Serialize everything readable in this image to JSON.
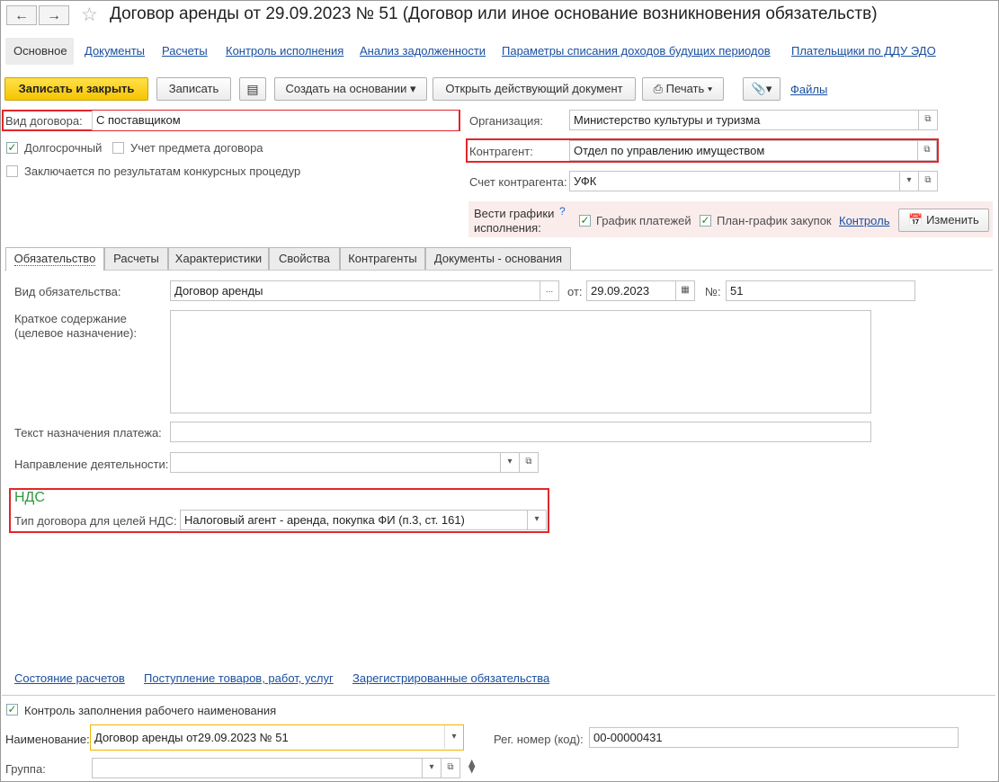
{
  "window": {
    "title": "Договор аренды от 29.09.2023 № 51 (Договор или иное основание возникновения обязательств)"
  },
  "nav_tabs": [
    "Основное",
    "Документы",
    "Расчеты",
    "Контроль исполнения",
    "Анализ задолженности",
    "Параметры списания доходов будущих периодов",
    "Плательщики по ДДУ ЭДО"
  ],
  "toolbar": {
    "save_close": "Записать и закрыть",
    "save": "Записать",
    "create_based": "Создать на основании",
    "open_doc": "Открыть действующий документ",
    "print": "Печать",
    "files": "Файлы"
  },
  "header": {
    "contract_type_label": "Вид договора:",
    "contract_type_value": "С поставщиком",
    "long_term": "Долгосрочный",
    "subject_accounting": "Учет предмета договора",
    "competitive": "Заключается по результатам конкурсных процедур",
    "org_label": "Организация:",
    "org_value": "Министерство культуры и туризма",
    "counterparty_label": "Контрагент:",
    "counterparty_value": "Отдел по управлению имуществом",
    "account_label": "Счет контрагента:",
    "account_value": "УФК",
    "schedules_label_1": "Вести графики",
    "schedules_label_2": "исполнения:",
    "help": "?",
    "payment_schedule": "График платежей",
    "purchase_schedule": "План-график закупок",
    "control_link": "Контроль",
    "change_btn": "Изменить"
  },
  "inner_tabs": [
    "Обязательство",
    "Расчеты",
    "Характеристики",
    "Свойства",
    "Контрагенты",
    "Документы - основания"
  ],
  "obligation": {
    "kind_label": "Вид обязательства:",
    "kind_value": "Договор аренды",
    "ellipsis": "...",
    "from_label": "от:",
    "date_value": "29.09.2023",
    "num_label": "№:",
    "num_value": "51",
    "summary_label_1": "Краткое содержание",
    "summary_label_2": "(целевое назначение):",
    "summary_value": "",
    "payment_text_label": "Текст назначения платежа:",
    "payment_text_value": "",
    "activity_label": "Направление деятельности:",
    "activity_value": "",
    "vat_header": "НДС",
    "vat_type_label": "Тип договора для целей НДС:",
    "vat_type_value": "Налоговый агент - аренда, покупка ФИ (п.3, ст. 161)"
  },
  "bottom_links": [
    "Состояние расчетов",
    "Поступление товаров, работ, услуг",
    "Зарегистрированные обязательства"
  ],
  "footer": {
    "name_control": "Контроль заполнения рабочего наименования",
    "name_label": "Наименование:",
    "name_value": "Договор аренды от29.09.2023  № 51",
    "reg_label": "Рег. номер (код):",
    "reg_value": "00-00000431",
    "group_label": "Группа:",
    "group_value": ""
  },
  "colors": {
    "accent_yellow": "#f6c500",
    "highlight_red": "#e0262b",
    "link_blue": "#1a4fa0",
    "vat_green": "#2e9a3e"
  }
}
